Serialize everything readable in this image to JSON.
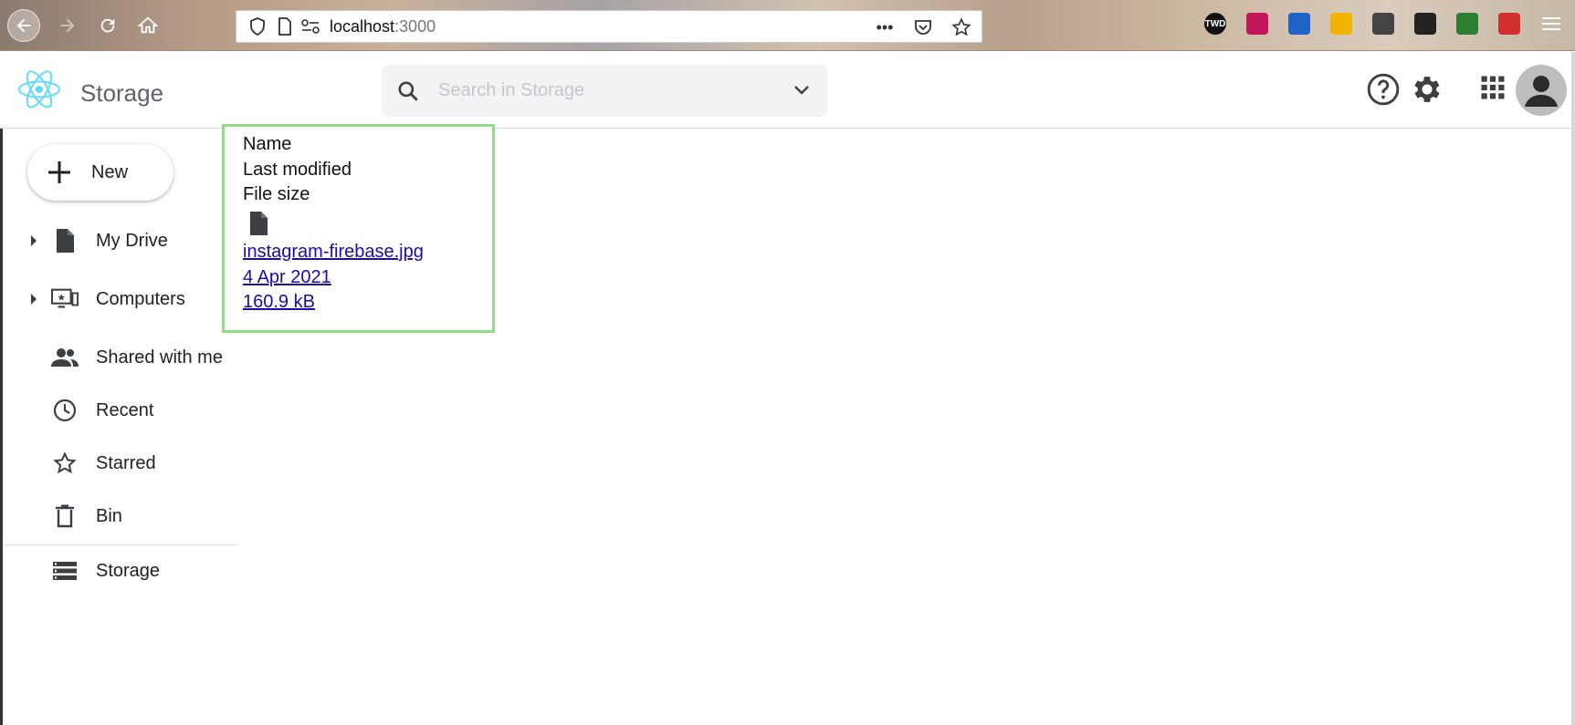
{
  "browser": {
    "url_host": "localhost",
    "url_port": ":3000",
    "page_actions": {
      "more": "•••"
    },
    "extensions": [
      {
        "name": "twd-extension-icon",
        "label": "TWD",
        "color": "#111111"
      },
      {
        "name": "red-flower-extension-icon",
        "label": "",
        "color": "#c2185b"
      },
      {
        "name": "blue-circle-extension-icon",
        "label": "",
        "color": "#1e63c7"
      },
      {
        "name": "yellow-extension-icon",
        "label": "",
        "color": "#f0b400"
      },
      {
        "name": "notepad-extension-icon",
        "label": "",
        "color": "#444444"
      },
      {
        "name": "gnome-foot-extension-icon",
        "label": "",
        "color": "#222222"
      },
      {
        "name": "globe-extension-icon",
        "label": "",
        "color": "#2e7d32"
      },
      {
        "name": "red-badge-extension-icon",
        "label": "",
        "color": "#d32f2f"
      }
    ]
  },
  "header": {
    "title": "Storage",
    "search_placeholder": "Search in Storage",
    "accent_color": "#61dafb"
  },
  "sidebar": {
    "new_label": "New",
    "items": [
      {
        "label": "My Drive",
        "icon": "file-icon",
        "expandable": true
      },
      {
        "label": "Computers",
        "icon": "computer-icon",
        "expandable": true
      },
      {
        "label": "Shared with me",
        "icon": "people-icon",
        "expandable": false
      },
      {
        "label": "Recent",
        "icon": "clock-icon",
        "expandable": false
      },
      {
        "label": "Starred",
        "icon": "star-icon",
        "expandable": false
      },
      {
        "label": "Bin",
        "icon": "trash-icon",
        "expandable": false
      },
      {
        "label": "Storage",
        "icon": "storage-icon",
        "expandable": false
      }
    ]
  },
  "file_list": {
    "headers": [
      "Name",
      "Last modified",
      "File size"
    ],
    "border_color": "#8fde86",
    "files": [
      {
        "name": "instagram-firebase.jpg",
        "modified": "4 Apr 2021",
        "size": "160.9 kB"
      }
    ]
  }
}
